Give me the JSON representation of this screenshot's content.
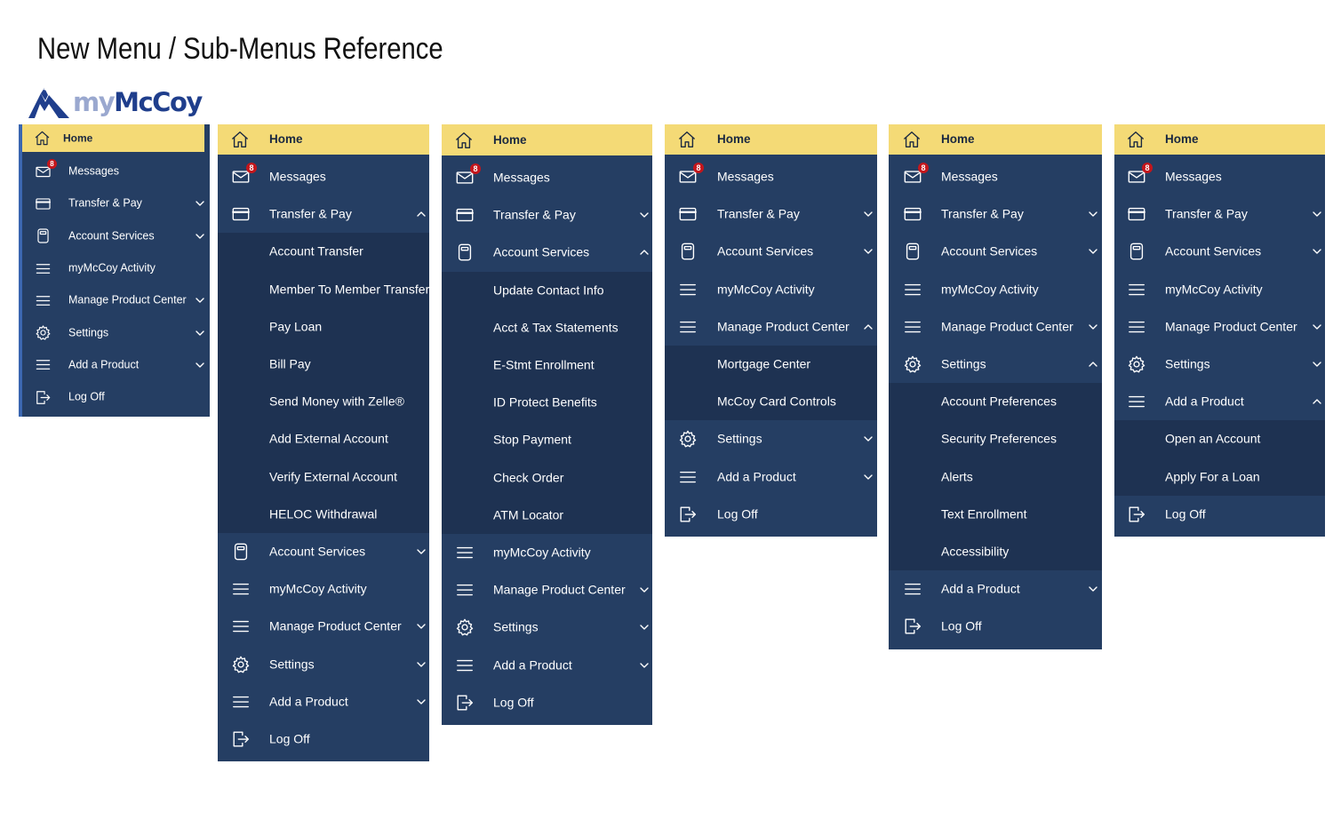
{
  "page": {
    "title": "New Menu / Sub-Menus Reference"
  },
  "logo": {
    "prefix": "my",
    "name": "McCoy"
  },
  "colors": {
    "home_bg": "#f4da76",
    "panel_bg": "#253e63",
    "submenu_bg": "#1e3252",
    "badge": "#c4161c",
    "logo_blue": "#1f3e8c"
  },
  "menus": [
    {
      "home_label": "Home",
      "items": [
        {
          "label": "Messages",
          "icon": "mail-icon",
          "badge": "8",
          "chevron": ""
        },
        {
          "label": "Transfer & Pay",
          "icon": "card-icon",
          "chevron": "down"
        },
        {
          "label": "Account Services",
          "icon": "calculator-icon",
          "chevron": "down"
        },
        {
          "label": "myMcCoy Activity",
          "icon": "menu-lines-icon",
          "chevron": ""
        },
        {
          "label": "Manage Product Center",
          "icon": "menu-lines-icon",
          "chevron": "down"
        },
        {
          "label": "Settings",
          "icon": "gear-icon",
          "chevron": "down"
        },
        {
          "label": "Add a Product",
          "icon": "menu-lines-icon",
          "chevron": "down"
        },
        {
          "label": "Log Off",
          "icon": "logout-icon",
          "chevron": ""
        }
      ]
    },
    {
      "home_label": "Home",
      "items": [
        {
          "label": "Messages",
          "icon": "mail-icon",
          "badge": "8",
          "chevron": ""
        },
        {
          "label": "Transfer & Pay",
          "icon": "card-icon",
          "chevron": "up"
        },
        {
          "label": "Account Transfer",
          "sub": true
        },
        {
          "label": "Member To Member Transfer",
          "sub": true
        },
        {
          "label": "Pay Loan",
          "sub": true
        },
        {
          "label": "Bill Pay",
          "sub": true
        },
        {
          "label": "Send Money with Zelle®",
          "sub": true
        },
        {
          "label": "Add External Account",
          "sub": true
        },
        {
          "label": "Verify External Account",
          "sub": true
        },
        {
          "label": "HELOC Withdrawal",
          "sub": true
        },
        {
          "label": "Account Services",
          "icon": "calculator-icon",
          "chevron": "down"
        },
        {
          "label": "myMcCoy Activity",
          "icon": "menu-lines-icon",
          "chevron": ""
        },
        {
          "label": "Manage Product Center",
          "icon": "menu-lines-icon",
          "chevron": "down"
        },
        {
          "label": "Settings",
          "icon": "gear-icon",
          "chevron": "down"
        },
        {
          "label": "Add a Product",
          "icon": "menu-lines-icon",
          "chevron": "down"
        },
        {
          "label": "Log Off",
          "icon": "logout-icon",
          "chevron": ""
        }
      ]
    },
    {
      "home_label": "Home",
      "items": [
        {
          "label": "Messages",
          "icon": "mail-icon",
          "badge": "8",
          "chevron": ""
        },
        {
          "label": "Transfer & Pay",
          "icon": "card-icon",
          "chevron": "down"
        },
        {
          "label": "Account Services",
          "icon": "calculator-icon",
          "chevron": "up"
        },
        {
          "label": "Update Contact Info",
          "sub": true
        },
        {
          "label": "Acct & Tax Statements",
          "sub": true
        },
        {
          "label": "E-Stmt Enrollment",
          "sub": true
        },
        {
          "label": "ID Protect Benefits",
          "sub": true
        },
        {
          "label": "Stop Payment",
          "sub": true
        },
        {
          "label": "Check Order",
          "sub": true
        },
        {
          "label": "ATM Locator",
          "sub": true
        },
        {
          "label": "myMcCoy Activity",
          "icon": "menu-lines-icon",
          "chevron": ""
        },
        {
          "label": "Manage Product Center",
          "icon": "menu-lines-icon",
          "chevron": "down"
        },
        {
          "label": "Settings",
          "icon": "gear-icon",
          "chevron": "down"
        },
        {
          "label": "Add a Product",
          "icon": "menu-lines-icon",
          "chevron": "down"
        },
        {
          "label": "Log Off",
          "icon": "logout-icon",
          "chevron": ""
        }
      ]
    },
    {
      "home_label": "Home",
      "items": [
        {
          "label": "Messages",
          "icon": "mail-icon",
          "badge": "8",
          "chevron": ""
        },
        {
          "label": "Transfer & Pay",
          "icon": "card-icon",
          "chevron": "down"
        },
        {
          "label": "Account Services",
          "icon": "calculator-icon",
          "chevron": "down"
        },
        {
          "label": "myMcCoy Activity",
          "icon": "menu-lines-icon",
          "chevron": ""
        },
        {
          "label": "Manage Product Center",
          "icon": "menu-lines-icon",
          "chevron": "up"
        },
        {
          "label": "Mortgage Center",
          "sub": true
        },
        {
          "label": "McCoy Card Controls",
          "sub": true
        },
        {
          "label": "Settings",
          "icon": "gear-icon",
          "chevron": "down"
        },
        {
          "label": "Add a Product",
          "icon": "menu-lines-icon",
          "chevron": "down"
        },
        {
          "label": "Log Off",
          "icon": "logout-icon",
          "chevron": ""
        }
      ]
    },
    {
      "home_label": "Home",
      "items": [
        {
          "label": "Messages",
          "icon": "mail-icon",
          "badge": "8",
          "chevron": ""
        },
        {
          "label": "Transfer & Pay",
          "icon": "card-icon",
          "chevron": "down"
        },
        {
          "label": "Account Services",
          "icon": "calculator-icon",
          "chevron": "down"
        },
        {
          "label": "myMcCoy Activity",
          "icon": "menu-lines-icon",
          "chevron": ""
        },
        {
          "label": "Manage Product Center",
          "icon": "menu-lines-icon",
          "chevron": "down"
        },
        {
          "label": "Settings",
          "icon": "gear-icon",
          "chevron": "up"
        },
        {
          "label": "Account Preferences",
          "sub": true
        },
        {
          "label": "Security Preferences",
          "sub": true
        },
        {
          "label": "Alerts",
          "sub": true
        },
        {
          "label": "Text Enrollment",
          "sub": true
        },
        {
          "label": "Accessibility",
          "sub": true
        },
        {
          "label": "Add a Product",
          "icon": "menu-lines-icon",
          "chevron": "down"
        },
        {
          "label": "Log Off",
          "icon": "logout-icon",
          "chevron": ""
        }
      ]
    },
    {
      "home_label": "Home",
      "items": [
        {
          "label": "Messages",
          "icon": "mail-icon",
          "badge": "8",
          "chevron": ""
        },
        {
          "label": "Transfer & Pay",
          "icon": "card-icon",
          "chevron": "down"
        },
        {
          "label": "Account Services",
          "icon": "calculator-icon",
          "chevron": "down"
        },
        {
          "label": "myMcCoy Activity",
          "icon": "menu-lines-icon",
          "chevron": ""
        },
        {
          "label": "Manage Product Center",
          "icon": "menu-lines-icon",
          "chevron": "down"
        },
        {
          "label": "Settings",
          "icon": "gear-icon",
          "chevron": "down"
        },
        {
          "label": "Add a Product",
          "icon": "menu-lines-icon",
          "chevron": "up"
        },
        {
          "label": "Open an Account",
          "sub": true
        },
        {
          "label": "Apply For a Loan",
          "sub": true
        },
        {
          "label": "Log Off",
          "icon": "logout-icon",
          "chevron": ""
        }
      ]
    }
  ]
}
